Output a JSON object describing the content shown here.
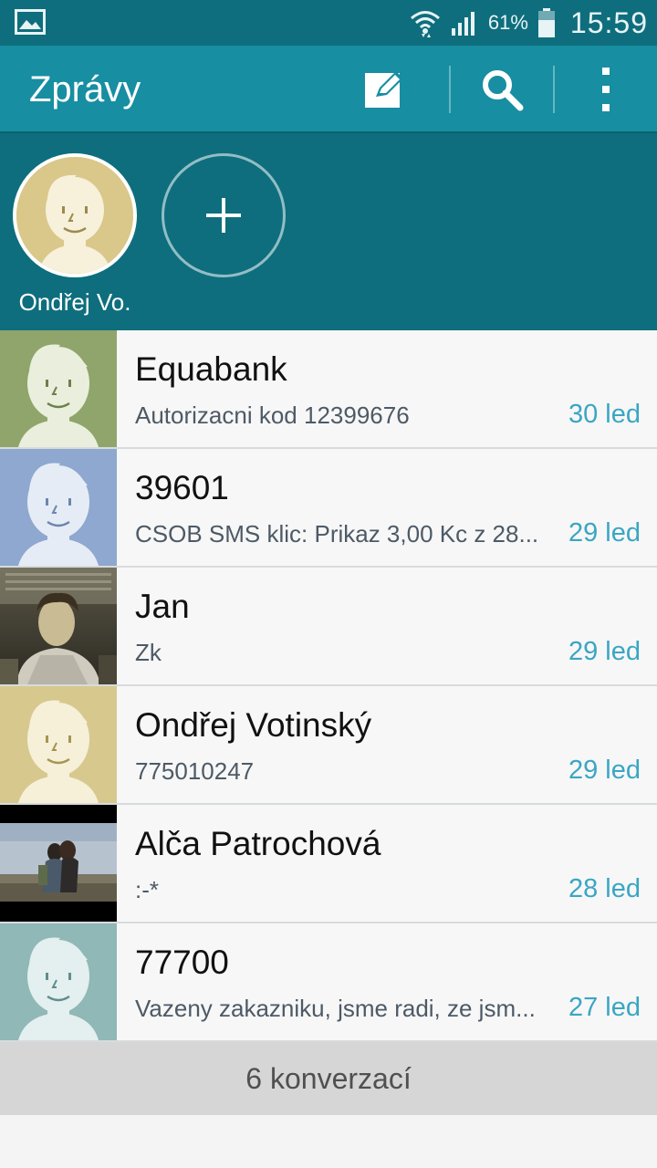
{
  "status_bar": {
    "battery_text": "61%",
    "time": "15:59",
    "icons": [
      "image-notification-icon",
      "wifi-icon",
      "signal-icon",
      "battery-icon"
    ]
  },
  "action_bar": {
    "title": "Zprávy",
    "icons": [
      "compose-icon",
      "search-icon",
      "more-vert-icon"
    ]
  },
  "favorites": {
    "contact_name": "Ondřej Vo.",
    "add_icon": "plus-icon"
  },
  "conversations": [
    {
      "name": "Equabank",
      "preview": "Autorizacni kod 12399676",
      "date": "30 led",
      "avatar": "default-avatar-green"
    },
    {
      "name": "39601",
      "preview": "CSOB SMS klic: Prikaz 3,00 Kc z 28...",
      "date": "29 led",
      "avatar": "default-avatar-blue"
    },
    {
      "name": "Jan",
      "preview": "Zk",
      "date": "29 led",
      "avatar": "photo-avatar"
    },
    {
      "name": "Ondřej Votinský",
      "preview": "775010247",
      "date": "29 led",
      "avatar": "default-avatar-yellow"
    },
    {
      "name": "Alča Patrochová",
      "preview": ":-*",
      "date": "28 led",
      "avatar": "photo-avatar"
    },
    {
      "name": "77700",
      "preview": "Vazeny zakazniku, jsme radi, ze jsm...",
      "date": "27 led",
      "avatar": "default-avatar-teal"
    }
  ],
  "footer": {
    "count_text": "6 konverzací"
  },
  "colors": {
    "status_bar": "#0e6e7d",
    "action_bar": "#178ea2",
    "date_accent": "#3aa6c3",
    "avatar_green": "#8fa56b",
    "avatar_blue": "#8ea8cf",
    "avatar_yellow": "#d7c88d",
    "avatar_teal": "#8fb8b7"
  }
}
